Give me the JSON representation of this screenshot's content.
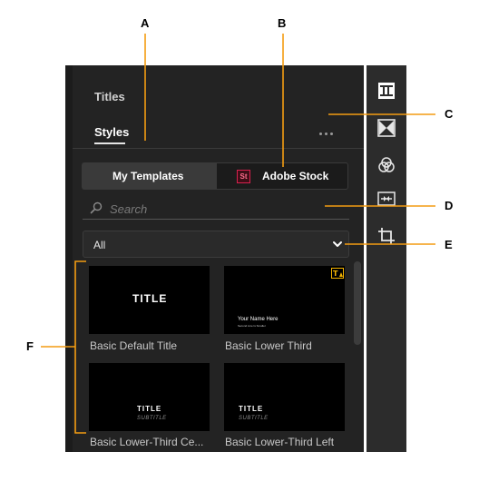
{
  "panel": {
    "tabs": [
      {
        "label": "Titles"
      },
      {
        "label": "Styles"
      }
    ],
    "more_label": "More options",
    "segments": {
      "my_templates": "My Templates",
      "adobe_stock": "Adobe Stock",
      "stock_badge": "St"
    },
    "search": {
      "placeholder": "Search",
      "value": ""
    },
    "filter": {
      "selected": "All"
    },
    "templates": [
      {
        "label": "Basic Default Title",
        "title": "TITLE"
      },
      {
        "label": "Basic Lower Third",
        "line1": "Your Name Here",
        "line2": "Second Line Is Smaller"
      },
      {
        "label": "Basic Lower-Third Ce...",
        "title": "TITLE",
        "subtitle": "SUBTITLE"
      },
      {
        "label": "Basic Lower-Third Left",
        "title": "TITLE",
        "subtitle": "SUBTITLE"
      }
    ]
  },
  "callouts": {
    "a": "A",
    "b": "B",
    "c": "C",
    "d": "D",
    "e": "E",
    "f": "F"
  },
  "colors": {
    "accent_callout": "#f39c12",
    "panel_bg": "#232323",
    "badge": "#d9214f",
    "stock_icon": "#f5b400"
  }
}
